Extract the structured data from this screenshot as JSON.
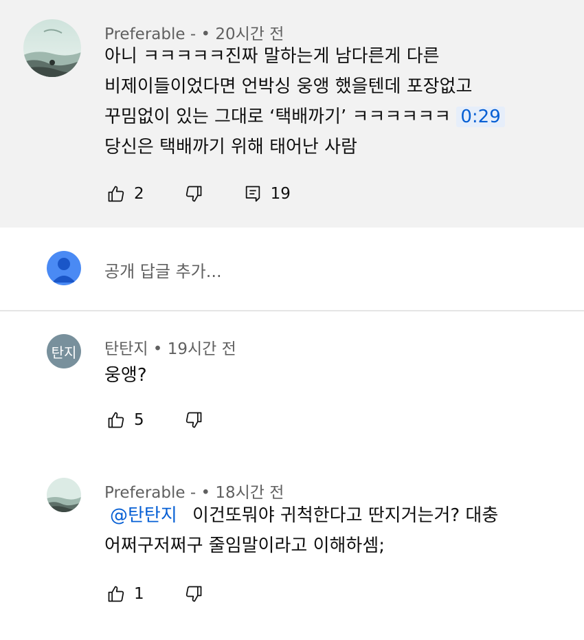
{
  "top_comment": {
    "author": "Preferable -",
    "time": "20시간 전",
    "lines": [
      "아니 ㅋㅋㅋㅋㅋ진짜 말하는게 남다른게 다른",
      "비제이들이었다면 언박싱 웅앵 했을텐데 포장없고",
      "꾸밈없이 있는 그대로 ‘택배까기’ ㅋㅋㅋㅋㅋㅋ",
      "당신은 택배까기 위해 태어난 사람"
    ],
    "timestamp_link": "0:29",
    "likes": "2",
    "replies": "19"
  },
  "reply_box": {
    "placeholder": "공개 답글 추가..."
  },
  "replies": [
    {
      "author": "탄탄지",
      "avatar_text": "탄지",
      "time": "19시간 전",
      "text": "웅앵?",
      "likes": "5"
    },
    {
      "author": "Preferable -",
      "time": "18시간 전",
      "mention": "@탄탄지",
      "line1": "이건또뭐야 귀척한다고 딴지거는거? 대충",
      "line2": "어쩌구저쩌구 줄임말이라고 이해하셈;",
      "likes": "1"
    }
  ],
  "separator": "•",
  "colors": {
    "link": "#065fd4",
    "meta": "#606060",
    "top_bg": "#f2f2f2",
    "user_avatar": "#4a8af4",
    "text_avatar": "#78909c"
  },
  "icons": [
    "thumbs-up-icon",
    "thumbs-down-icon",
    "reply-comment-icon",
    "user-avatar-icon"
  ]
}
